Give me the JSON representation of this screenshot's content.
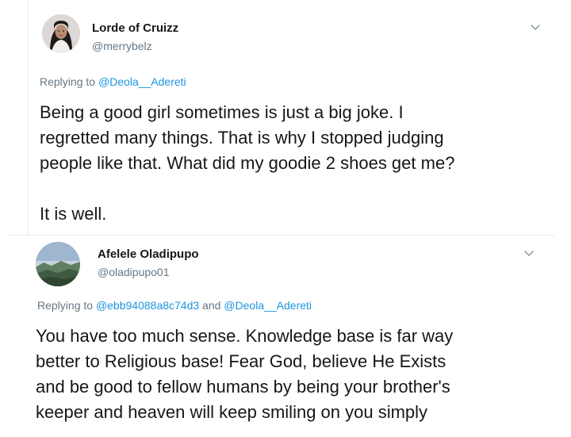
{
  "tweets": [
    {
      "display_name": "Lorde of Cruizz",
      "handle": "@merrybelz",
      "replying_prefix": "Replying to ",
      "reply_mention_1": "@Deola__Adereti",
      "body_line_1": "Being a good girl sometimes is just a big joke. I",
      "body_line_2": "regretted many things. That is why I stopped judging",
      "body_line_3": "people like that. What did my goodie 2 shoes get me?",
      "body_line_4": "",
      "body_line_5": "It is well."
    },
    {
      "display_name": "Afelele Oladipupo",
      "handle": "@oladipupo01",
      "replying_prefix": "Replying to ",
      "reply_mention_1": "@ebb94088a8c74d3",
      "reply_conjunction": " and ",
      "reply_mention_2": "@Deola__Adereti",
      "body_line_1": "You have too much sense. Knowledge base is far way",
      "body_line_2": "better to Religious base! Fear God, believe He Exists",
      "body_line_3": "and be good to fellow humans by being your brother's",
      "body_line_4": "keeper and heaven will keep smiling on you simply"
    }
  ],
  "colors": {
    "text": "#14171a",
    "secondary": "#657786",
    "link": "#1b95e0",
    "divider": "#e6ecf0"
  },
  "icons": {
    "more_menu": "chevron-down-icon",
    "avatar_1": "profile-photo",
    "avatar_2": "landscape-photo"
  }
}
